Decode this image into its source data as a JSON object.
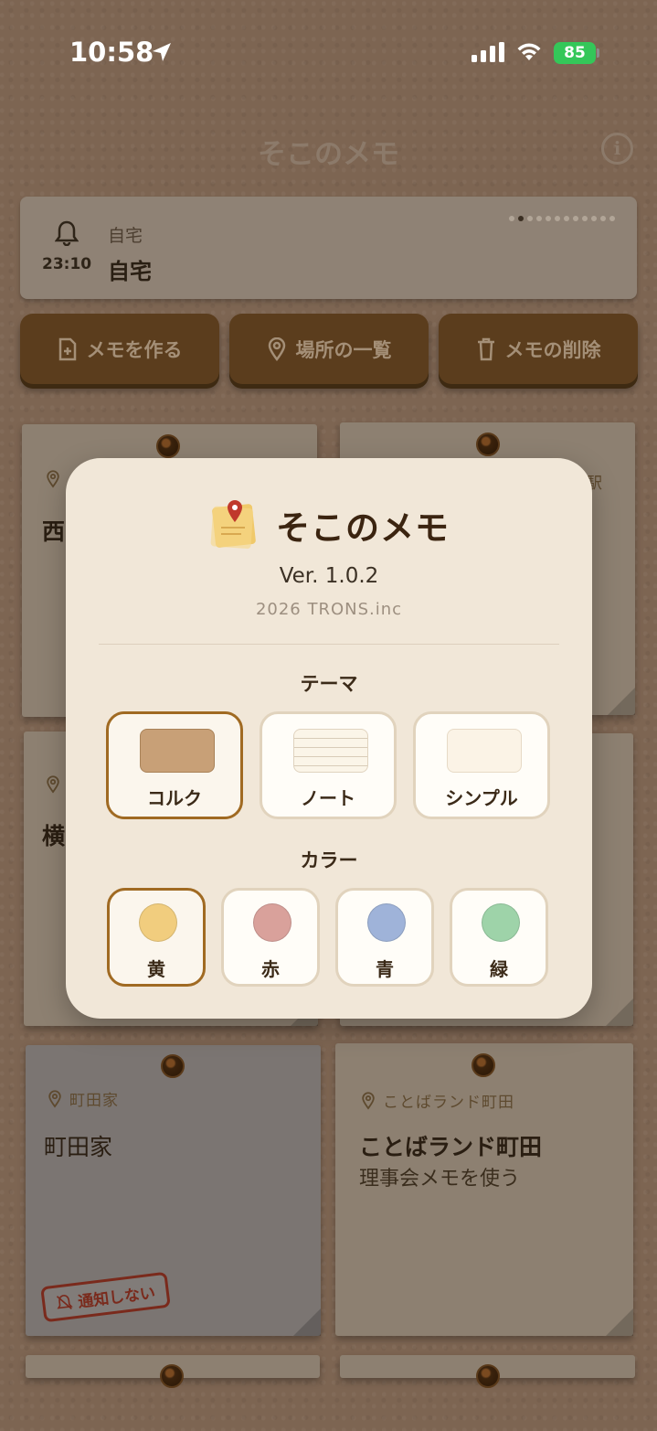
{
  "status_bar": {
    "time": "10:58",
    "battery": "85"
  },
  "header": {
    "title": "そこのメモ"
  },
  "banner": {
    "time": "23:10",
    "subtitle": "自宅",
    "title": "自宅"
  },
  "actions": {
    "create": "メモを作る",
    "places": "場所の一覧",
    "delete": "メモの削除"
  },
  "cards": [
    {
      "location": "",
      "title": "西"
    },
    {
      "location": "駅",
      "title": ""
    },
    {
      "location": "",
      "title": "横"
    },
    {
      "location": "町田家",
      "title": "町田家",
      "badge": "通知しない"
    },
    {
      "location": "ことばランド町田",
      "title": "ことばランド町田",
      "body": "理事会メモを使う"
    }
  ],
  "dialog": {
    "title": "そこのメモ",
    "version": "Ver. 1.0.2",
    "copyright": "2026 TRONS.inc",
    "theme_label": "テーマ",
    "themes": [
      {
        "label": "コルク",
        "selected": true
      },
      {
        "label": "ノート",
        "selected": false
      },
      {
        "label": "シンプル",
        "selected": false
      }
    ],
    "color_label": "カラー",
    "colors": [
      {
        "label": "黄",
        "hex": "#f1cd7e",
        "selected": true
      },
      {
        "label": "赤",
        "hex": "#d9a19b",
        "selected": false
      },
      {
        "label": "青",
        "hex": "#9fb3d9",
        "selected": false
      },
      {
        "label": "緑",
        "hex": "#9ed3a9",
        "selected": false
      }
    ]
  },
  "theme_colors": {
    "cork": "#7d6552",
    "accent": "#a06a22",
    "dialog_bg": "#f1e7d8"
  }
}
